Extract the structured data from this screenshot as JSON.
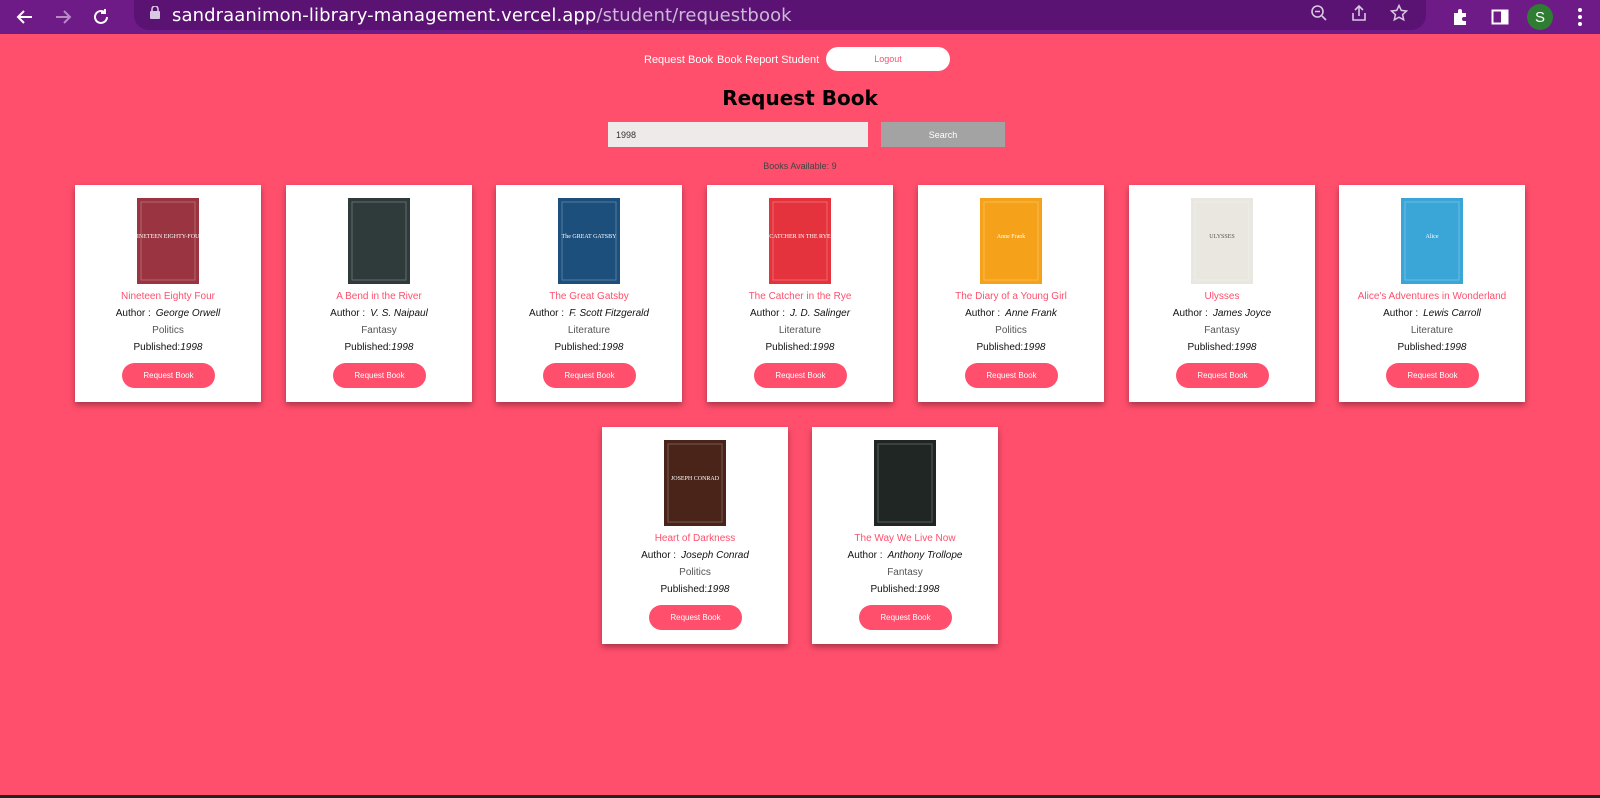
{
  "browser": {
    "url_host": "sandraanimon-library-management.vercel.app",
    "url_path": "/student/requestbook",
    "avatar_letter": "S"
  },
  "nav": {
    "request_book": "Request Book",
    "book_report": "Book Report Student",
    "logout": "Logout"
  },
  "page": {
    "title": "Request Book",
    "search_value": "1998",
    "search_button": "Search",
    "books_available": "Books Available: 9"
  },
  "books": [
    {
      "title": "Nineteen Eighty Four",
      "author_label": "Author :",
      "author": "George Orwell",
      "genre": "Politics",
      "published_label": "Published:",
      "year": "1998",
      "button": "Request Book",
      "cover_color": "#9a3440",
      "cover_text": "NINETEEN EIGHTY-FOUR"
    },
    {
      "title": "A Bend in the River",
      "author_label": "Author :",
      "author": "V. S. Naipaul",
      "genre": "Fantasy",
      "published_label": "Published:",
      "year": "1998",
      "button": "Request Book",
      "cover_color": "#2f3a3b",
      "cover_text": ""
    },
    {
      "title": "The Great Gatsby",
      "author_label": "Author :",
      "author": "F. Scott Fitzgerald",
      "genre": "Literature",
      "published_label": "Published:",
      "year": "1998",
      "button": "Request Book",
      "cover_color": "#1c4f7c",
      "cover_text": "The GREAT GATSBY"
    },
    {
      "title": "The Catcher in the Rye",
      "author_label": "Author :",
      "author": "J. D. Salinger",
      "genre": "Literature",
      "published_label": "Published:",
      "year": "1998",
      "button": "Request Book",
      "cover_color": "#e5333d",
      "cover_text": "CATCHER IN THE RYE"
    },
    {
      "title": "The Diary of a Young Girl",
      "author_label": "Author :",
      "author": "Anne Frank",
      "genre": "Politics",
      "published_label": "Published:",
      "year": "1998",
      "button": "Request Book",
      "cover_color": "#f5a21a",
      "cover_text": "Anne Frank"
    },
    {
      "title": "Ulysses",
      "author_label": "Author :",
      "author": "James Joyce",
      "genre": "Fantasy",
      "published_label": "Published:",
      "year": "1998",
      "button": "Request Book",
      "cover_color": "#e9e7e0",
      "cover_text": "ULYSSES"
    },
    {
      "title": "Alice's Adventures in Wonderland",
      "author_label": "Author :",
      "author": "Lewis Carroll",
      "genre": "Literature",
      "published_label": "Published:",
      "year": "1998",
      "button": "Request Book",
      "cover_color": "#3aa6d8",
      "cover_text": "Alice"
    },
    {
      "title": "Heart of Darkness",
      "author_label": "Author :",
      "author": "Joseph Conrad",
      "genre": "Politics",
      "published_label": "Published:",
      "year": "1998",
      "button": "Request Book",
      "cover_color": "#4a2418",
      "cover_text": "JOSEPH CONRAD"
    },
    {
      "title": "The Way We Live Now",
      "author_label": "Author :",
      "author": "Anthony Trollope",
      "genre": "Fantasy",
      "published_label": "Published:",
      "year": "1998",
      "button": "Request Book",
      "cover_color": "#1f2624",
      "cover_text": ""
    }
  ]
}
